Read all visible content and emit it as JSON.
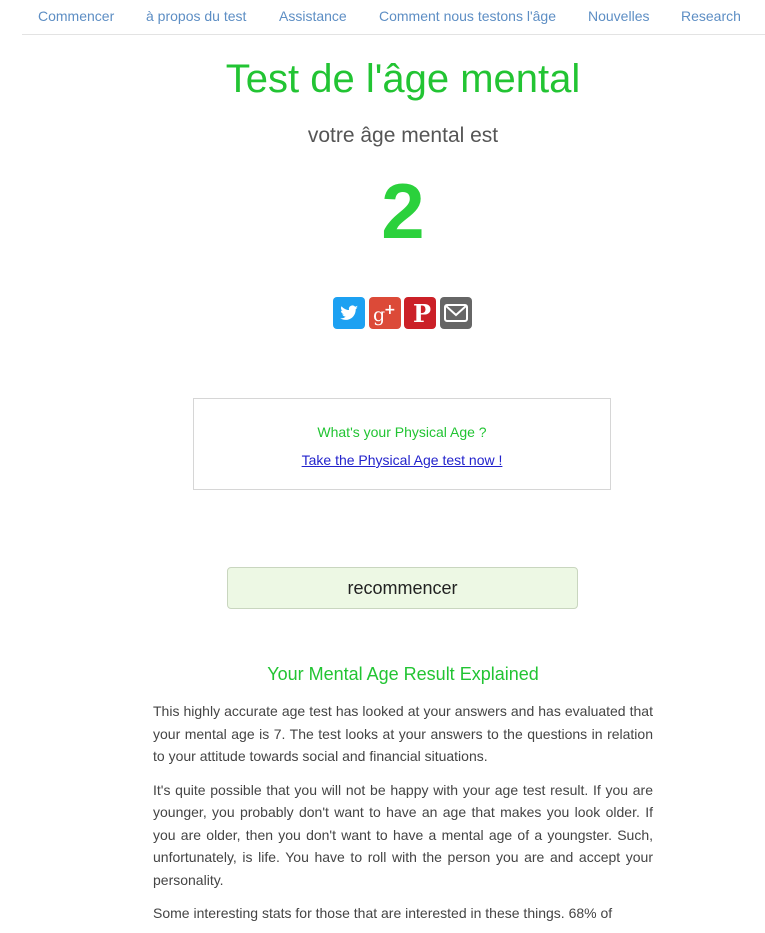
{
  "nav": {
    "items": [
      {
        "label": "Commencer"
      },
      {
        "label": "à propos du test"
      },
      {
        "label": "Assistance"
      },
      {
        "label": "Comment nous testons l'âge"
      },
      {
        "label": "Nouvelles"
      },
      {
        "label": "Research"
      }
    ]
  },
  "hero": {
    "title": "Test de l'âge mental",
    "subtitle": "votre âge mental est",
    "age_value": "2"
  },
  "share": {
    "buttons": [
      {
        "icon": "twitter-icon",
        "color": "#1da1f2"
      },
      {
        "icon": "google-plus-icon",
        "color": "#dc4a38"
      },
      {
        "icon": "pinterest-icon",
        "color": "#cb2027"
      },
      {
        "icon": "email-icon",
        "color": "#666666"
      }
    ]
  },
  "promo": {
    "question": "What's your Physical Age ?",
    "link_text": "Take the Physical Age test now !"
  },
  "restart": {
    "label": "recommencer"
  },
  "explained": {
    "heading": "Your Mental Age Result Explained",
    "paragraphs": [
      "This highly accurate age test has looked at your answers and has evaluated that your mental age is 7. The test looks at your answers to the questions in relation to your attitude towards social and financial situations.",
      "It's quite possible that you will not be happy with your age test result. If you are younger, you probably don't want to have an age that makes you look older. If you are older, then you don't want to have a mental age of a youngster. Such, unfortunately, is life. You have to roll with the person you are and accept your personality.",
      "Some interesting stats for those that are interested in these things. 68% of"
    ]
  },
  "colors": {
    "accent_green": "#22c433",
    "nav_blue": "#5d8ec4",
    "link_blue": "#2222cc",
    "button_bg": "#edf8e4"
  }
}
